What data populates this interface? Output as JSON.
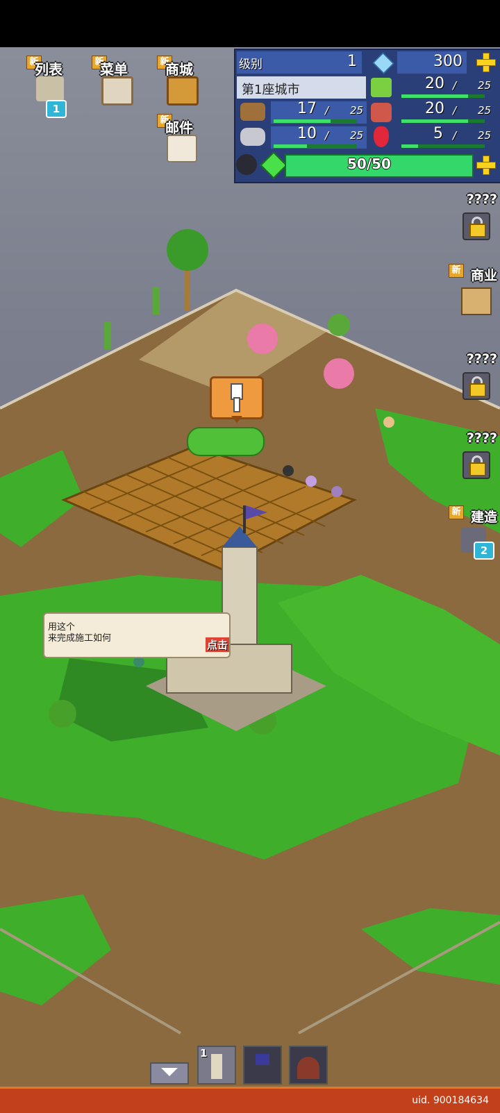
{
  "top_menu": {
    "new_tag": "新",
    "list_label": "列表",
    "list_badge": "1",
    "menu_label": "菜单",
    "shop_label": "商城",
    "mail_label": "邮件"
  },
  "resources": {
    "level_label": "级别",
    "level_value": "1",
    "gems": "300",
    "city_name": "第1座城市",
    "food_value": "20",
    "food_max": "25",
    "food_fill": 0.8,
    "wood_value": "17",
    "wood_max": "25",
    "wood_fill": 0.68,
    "meat_value": "20",
    "meat_max": "25",
    "meat_fill": 0.8,
    "stone_value": "10",
    "stone_max": "25",
    "stone_fill": 0.4,
    "ruby_value": "5",
    "ruby_max": "25",
    "ruby_fill": 0.2,
    "energy_text": "50/50",
    "energy_fill": 1.0
  },
  "side_menu": {
    "locked_label": "????",
    "commerce_label": "商业",
    "build_label": "建造",
    "build_badge": "2",
    "new_tag": "新"
  },
  "tutorial": {
    "line1": "用这个",
    "line2": "来完成施工如何",
    "tap_label": "点击"
  },
  "toolbar": {
    "slot1_count": "1"
  },
  "footer": {
    "uid": "uid. 900184634"
  },
  "colors": {
    "grass": "#3fae2a",
    "dirt": "#8a6a3e",
    "sky": "#7b7f8d",
    "accent_orange": "#c2401a"
  }
}
